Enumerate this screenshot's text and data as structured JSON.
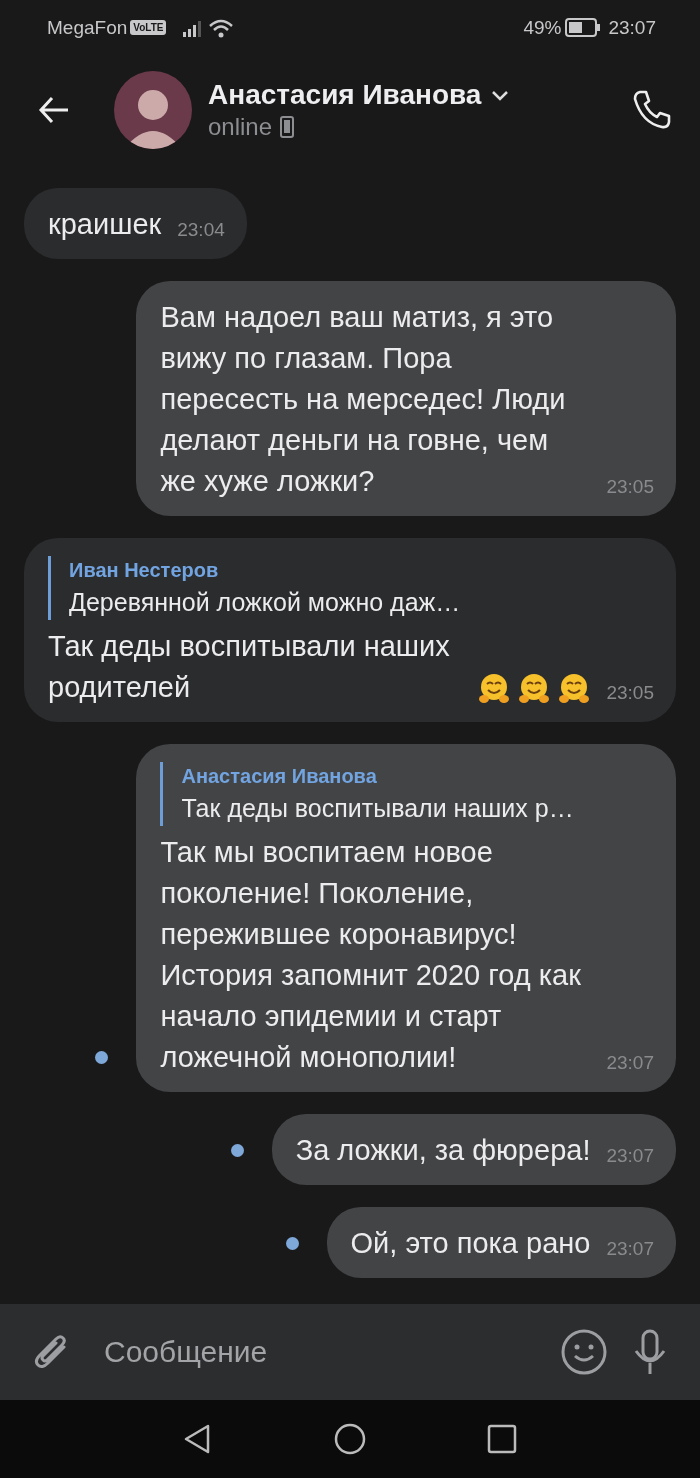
{
  "status_bar": {
    "carrier": "MegaFon",
    "network_badge": "VoLTE",
    "battery": "49%",
    "time": "23:07"
  },
  "header": {
    "name": "Анастасия Иванова",
    "status": "online"
  },
  "messages": [
    {
      "kind": "incoming",
      "text": "краишек",
      "time": "23:04",
      "unread": false
    },
    {
      "kind": "outgoing",
      "text": "Вам надоел ваш матиз, я это вижу по глазам. Пора пересесть на мерседес! Люди делают деньги на говне, чем же хуже ложки?",
      "time": "23:05",
      "unread": false
    },
    {
      "kind": "incoming",
      "reply": {
        "author": "Иван Нестеров",
        "text": "Деревянной ложкой можно даж…"
      },
      "text": "Так деды воспитывали наших родителей",
      "emojis": [
        {
          "kind": "hugging"
        },
        {
          "kind": "hugging"
        },
        {
          "kind": "hugging"
        }
      ],
      "time": "23:05",
      "unread": false
    },
    {
      "kind": "outgoing",
      "reply": {
        "author": "Анастасия Иванова",
        "text": "Так деды воспитывали наших р…"
      },
      "text": "Так мы воспитаем новое поколение! Поколение, пережившее коронавирус! История запомнит 2020 год как начало эпидемии и старт ложечной монополии!",
      "time": "23:07",
      "unread": true
    },
    {
      "kind": "outgoing",
      "text": "За ложки, за фюрера!",
      "time": "23:07",
      "unread": true
    },
    {
      "kind": "outgoing",
      "text": "Ой, это пока рано",
      "time": "23:07",
      "unread": true
    }
  ],
  "composer": {
    "placeholder": "Сообщение"
  }
}
